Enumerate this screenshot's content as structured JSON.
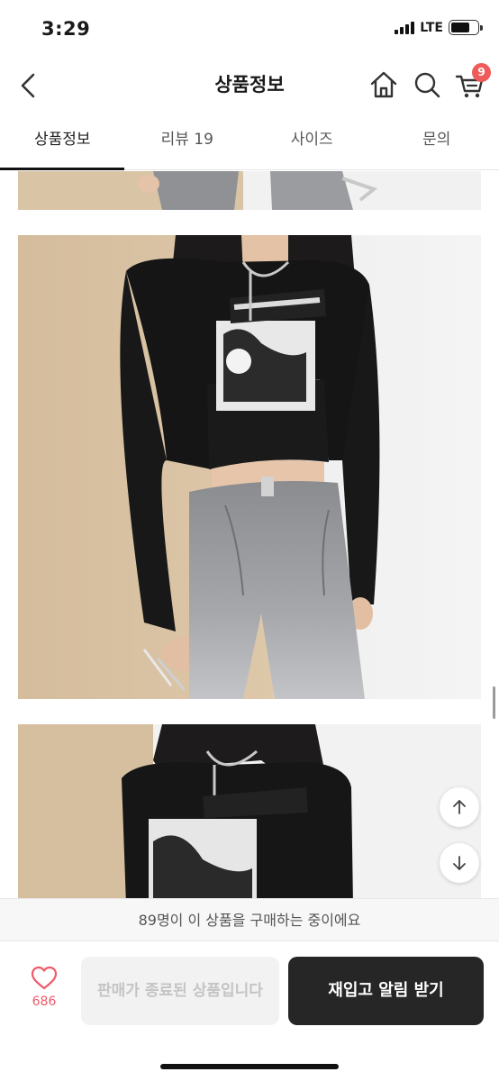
{
  "status_bar": {
    "time": "3:29",
    "network": "LTE",
    "battery_level": 0.7
  },
  "header": {
    "title": "상품정보",
    "cart_count": "9"
  },
  "tabs": [
    {
      "label": "상품정보",
      "active": true
    },
    {
      "label": "리뷰 19",
      "active": false
    },
    {
      "label": "사이즈",
      "active": false
    },
    {
      "label": "문의",
      "active": false
    }
  ],
  "notice": "89명이 이 상품을 구매하는 중이에요",
  "bottom_bar": {
    "like_count": "686",
    "soldout_label": "판매가 종료된 상품입니다",
    "restock_label": "재입고 알림 받기"
  },
  "colors": {
    "accent": "#f05a5a",
    "like": "#ef5a6a",
    "primary_button": "#262626"
  },
  "icons": [
    "back-chevron-icon",
    "home-icon",
    "search-icon",
    "cart-icon",
    "heart-icon",
    "arrow-up-icon",
    "arrow-down-icon"
  ]
}
